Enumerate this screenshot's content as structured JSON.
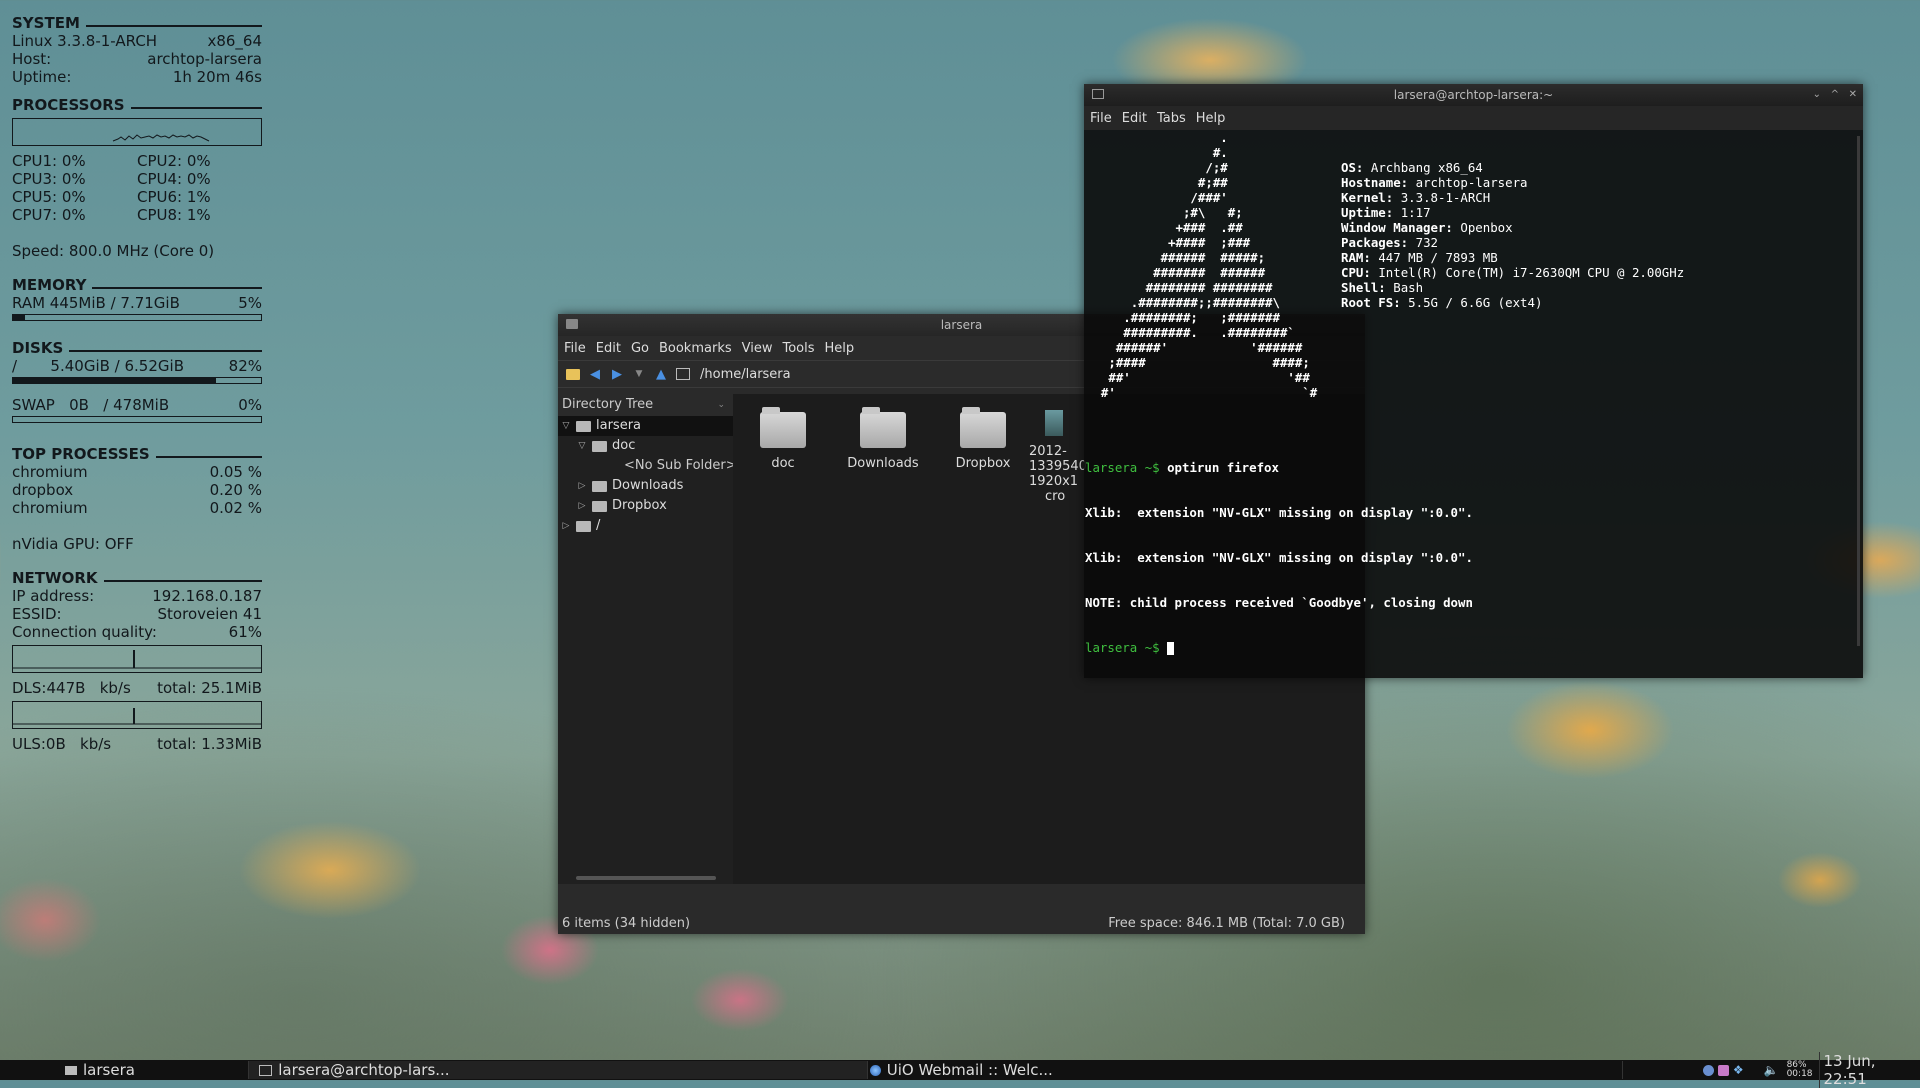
{
  "conky": {
    "system": {
      "title": "SYSTEM",
      "os": "Linux 3.3.8-1-ARCH",
      "arch": "x86_64",
      "host_label": "Host:",
      "host": "archtop-larsera",
      "uptime_label": "Uptime:",
      "uptime": "1h 20m 46s"
    },
    "processors": {
      "title": "PROCESSORS",
      "cpus": [
        "CPU1: 0%",
        "CPU2: 0%",
        "CPU3: 0%",
        "CPU4: 0%",
        "CPU5: 0%",
        "CPU6: 1%",
        "CPU7: 0%",
        "CPU8: 1%"
      ],
      "speed": "Speed:  800.0 MHz (Core 0)"
    },
    "memory": {
      "title": "MEMORY",
      "ram_label": "RAM  445MiB / 7.71GiB",
      "ram_pct": "5%",
      "ram_fill": 0.05
    },
    "disks": {
      "title": "DISKS",
      "root_label": "/       5.40GiB / 6.52GiB",
      "root_pct": "82%",
      "root_fill": 0.82,
      "swap_label": "SWAP   0B   / 478MiB",
      "swap_pct": "0%",
      "swap_fill": 0
    },
    "top": {
      "title": "TOP PROCESSES",
      "procs": [
        {
          "name": "chromium",
          "pct": "0.05 %"
        },
        {
          "name": "dropbox",
          "pct": "0.20 %"
        },
        {
          "name": "chromium",
          "pct": "0.02 %"
        }
      ]
    },
    "gpu": "nVidia GPU: OFF",
    "network": {
      "title": "NETWORK",
      "ip_label": "IP address:",
      "ip": "192.168.0.187",
      "essid_label": "ESSID:",
      "essid": "Storoveien 41",
      "quality_label": "Connection quality:",
      "quality": "61%",
      "dl": "DLS:447B   kb/s",
      "dl_total": "total: 25.1MiB",
      "ul": "ULS:0B   kb/s",
      "ul_total": "total: 1.33MiB"
    }
  },
  "filemanager": {
    "title": "larsera",
    "menu": [
      "File",
      "Edit",
      "Go",
      "Bookmarks",
      "View",
      "Tools",
      "Help"
    ],
    "path": "/home/larsera",
    "tree_header": "Directory Tree",
    "tree": {
      "root": "larsera",
      "doc": "doc",
      "nosub": "<No Sub Folder>",
      "downloads": "Downloads",
      "dropbox": "Dropbox",
      "slash": "/"
    },
    "items": [
      {
        "name": "doc"
      },
      {
        "name": "Downloads"
      },
      {
        "name": "Dropbox"
      }
    ],
    "partial_item": [
      "2012-",
      "1339540",
      "1920x1",
      "cro"
    ],
    "status_left": "6 items (34 hidden)",
    "status_right": "Free space: 846.1 MB (Total: 7.0 GB)"
  },
  "terminal": {
    "title": "larsera@archtop-larsera:~",
    "menu": [
      "File",
      "Edit",
      "Tabs",
      "Help"
    ],
    "logo": "                  .\n                 #.\n                /;#\n               #;##\n              /###'\n             ;#\\   #;\n            +###  .##\n           +####  ;###\n          ######  #####;\n         #######  ######\n        ######## ########\n      .########;;########\\\n     .########;   ;#######\n     #########.   .########`\n    ######'           '######\n   ;####                 ####;\n   ##'                     '##\n  #'                         `#",
    "info": [
      {
        "k": "OS:",
        "v": "Archbang x86_64"
      },
      {
        "k": "Hostname:",
        "v": "archtop-larsera"
      },
      {
        "k": "Kernel:",
        "v": "3.3.8-1-ARCH"
      },
      {
        "k": "Uptime:",
        "v": "1:17"
      },
      {
        "k": "Window Manager:",
        "v": "Openbox"
      },
      {
        "k": "Packages:",
        "v": "732"
      },
      {
        "k": "RAM:",
        "v": "447 MB / 7893 MB"
      },
      {
        "k": "CPU:",
        "v": "Intel(R) Core(TM) i7-2630QM CPU @ 2.00GHz"
      },
      {
        "k": "Shell:",
        "v": "Bash"
      },
      {
        "k": "Root FS:",
        "v": "5.5G / 6.6G (ext4)"
      }
    ],
    "prompt": "larsera ~$",
    "cmd": "optirun firefox",
    "out1": "Xlib:  extension \"NV-GLX\" missing on display \":0.0\".",
    "out2": "Xlib:  extension \"NV-GLX\" missing on display \":0.0\".",
    "out3": "NOTE: child process received `Goodbye', closing down"
  },
  "taskbar": {
    "tasks": [
      "larsera",
      "larsera@archtop-lars...",
      "UiO Webmail :: Welc..."
    ],
    "battery": "86%",
    "battery_time": "00:18",
    "clock": "13 Jun, 22:51"
  }
}
